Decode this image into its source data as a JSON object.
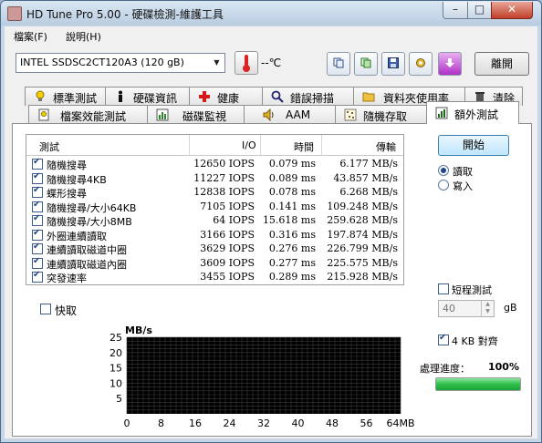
{
  "window": {
    "title": "HD Tune Pro  5.00 - 硬碟檢測-維護工具",
    "min_label": "–",
    "max_label": "□",
    "close_label": "✕"
  },
  "menu": {
    "items": [
      {
        "label": "檔案(F)"
      },
      {
        "label": "說明(H)"
      }
    ]
  },
  "toolbar": {
    "drive": "INTEL SSDSC2CT120A3 (120 gB)",
    "temperature": "--℃",
    "exit_label": "離開"
  },
  "tabs": {
    "row1": [
      {
        "label": "標準測試",
        "icon": "lightbulb-icon"
      },
      {
        "label": "硬碟資訊",
        "icon": "info-icon"
      },
      {
        "label": "健康",
        "icon": "health-cross-icon"
      },
      {
        "label": "錯誤掃描",
        "icon": "scan-icon"
      },
      {
        "label": "資料夾使用率",
        "icon": "folder-icon"
      },
      {
        "label": "清除",
        "icon": "trash-icon"
      }
    ],
    "row2": [
      {
        "label": "檔案效能測試",
        "icon": "file-benchmark-icon"
      },
      {
        "label": "磁碟監視",
        "icon": "disk-monitor-icon"
      },
      {
        "label": "AAM",
        "icon": "speaker-icon"
      },
      {
        "label": "隨機存取",
        "icon": "random-access-icon"
      },
      {
        "label": "額外測試",
        "icon": "extra-tests-icon"
      }
    ]
  },
  "results": {
    "headers": {
      "test": "測試",
      "io": "I/O",
      "time": "時間",
      "rate": "傳輸"
    },
    "rows": [
      {
        "name": "隨機搜尋",
        "io": "12650 IOPS",
        "time": "0.079 ms",
        "rate": "6.177 MB/s",
        "checked": true
      },
      {
        "name": "隨機搜尋4KB",
        "io": "11227 IOPS",
        "time": "0.089 ms",
        "rate": "43.857 MB/s",
        "checked": true
      },
      {
        "name": "蝶形搜尋",
        "io": "12838 IOPS",
        "time": "0.078 ms",
        "rate": "6.268 MB/s",
        "checked": true
      },
      {
        "name": "隨機搜尋/大小64KB",
        "io": "7105 IOPS",
        "time": "0.141 ms",
        "rate": "109.248 MB/s",
        "checked": true
      },
      {
        "name": "隨機搜尋/大小8MB",
        "io": "64 IOPS",
        "time": "15.618 ms",
        "rate": "259.628 MB/s",
        "checked": true
      },
      {
        "name": "外圈連續讀取",
        "io": "3166 IOPS",
        "time": "0.316 ms",
        "rate": "197.874 MB/s",
        "checked": true
      },
      {
        "name": "連續讀取磁道中圈",
        "io": "3629 IOPS",
        "time": "0.276 ms",
        "rate": "226.799 MB/s",
        "checked": true
      },
      {
        "name": "連續讀取磁道內圈",
        "io": "3609 IOPS",
        "time": "0.277 ms",
        "rate": "225.575 MB/s",
        "checked": true
      },
      {
        "name": "突發速率",
        "io": "3455 IOPS",
        "time": "0.289 ms",
        "rate": "215.928 MB/s",
        "checked": true
      }
    ]
  },
  "quick": {
    "label": "快取",
    "checked": false
  },
  "controls": {
    "start_label": "開始",
    "read_label": "讀取",
    "write_label": "寫入",
    "selected_mode": "read",
    "short_test_label": "短程測試",
    "short_test_checked": false,
    "size_value": "40",
    "size_unit": "gB",
    "align_label": "4 KB 對齊",
    "align_checked": true
  },
  "progress": {
    "label": "處理進度：",
    "value_text": "100%",
    "fraction": 1.0
  },
  "chart_data": {
    "type": "line",
    "ylabel": "MB/s",
    "y_ticks": [
      "25",
      "20",
      "15",
      "10",
      "5"
    ],
    "x_ticks": [
      "0",
      "8",
      "16",
      "24",
      "32",
      "40",
      "48",
      "56",
      "64MB"
    ],
    "ylim": [
      0,
      25
    ],
    "xlim": [
      0,
      64
    ],
    "grid": true,
    "series": []
  },
  "colors": {
    "progress": "#2fbf4a",
    "chart_bg": "#000000",
    "grid": "#3a3a3a",
    "close": "#c0402a"
  }
}
